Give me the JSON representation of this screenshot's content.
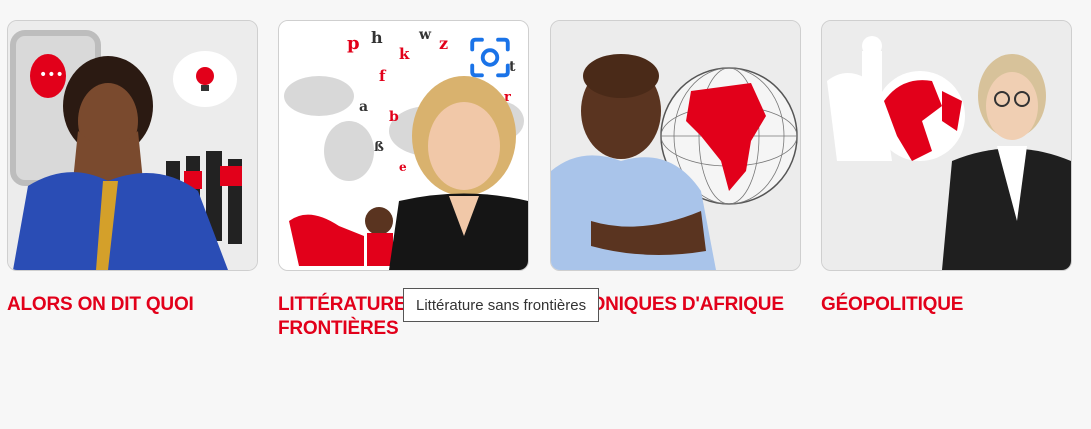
{
  "cards": [
    {
      "title": "ALORS ON DIT QUOI",
      "image_alt": "presenter-woman-blue-dress"
    },
    {
      "title": "LITTÉRATURE SANS\nFRONTIÈRES",
      "image_alt": "presenter-blonde-woman-letters"
    },
    {
      "title": "CHRONIQUES D'AFRIQUE",
      "image_alt": "presenter-man-africa-globe"
    },
    {
      "title": "GÉOPOLITIQUE",
      "image_alt": "presenter-woman-glasses-globe"
    }
  ],
  "tooltip": {
    "text": "Littérature sans frontières"
  },
  "icons": {
    "lens": "visual-search-icon"
  },
  "colors": {
    "accent": "#e2001a",
    "background": "#f7f7f7"
  }
}
